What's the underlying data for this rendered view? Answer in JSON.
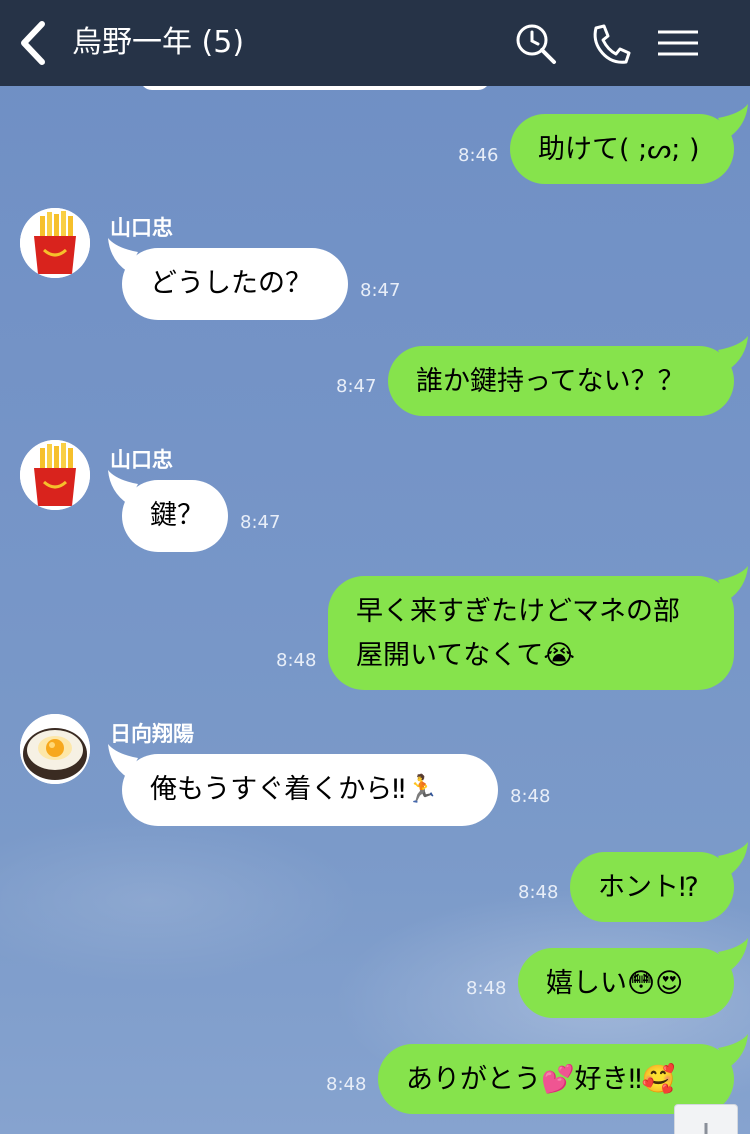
{
  "header": {
    "title": "烏野一年 (5)",
    "icons": [
      "back-chevron-icon",
      "search-icon",
      "phone-icon",
      "menu-icon"
    ]
  },
  "messages": [
    {
      "side": "out",
      "text": "助けて( ;ᔕ; )",
      "time": "8:46"
    },
    {
      "side": "in",
      "sender": "山口忠",
      "avatar": "fries-icon",
      "text": "どうしたの？",
      "time": "8:47"
    },
    {
      "side": "out",
      "text": "誰か鍵持ってない？？",
      "time": "8:47"
    },
    {
      "side": "in",
      "sender": "山口忠",
      "avatar": "fries-icon",
      "text": "鍵？",
      "time": "8:47"
    },
    {
      "side": "out",
      "text_line1": "早く来すぎたけどマネの部",
      "text_line2": "屋開いてなくて😭",
      "time": "8:48"
    },
    {
      "side": "in",
      "sender": "日向翔陽",
      "avatar": "egg-rice-icon",
      "text": "俺もうすぐ着くから‼🏃",
      "time": "8:48"
    },
    {
      "side": "out",
      "text": "ホント⁉",
      "time": "8:48"
    },
    {
      "side": "out",
      "text": "嬉しい😳😍",
      "time": "8:48"
    },
    {
      "side": "out",
      "text": "ありがとう💕好き‼🥰",
      "time": "8:48"
    }
  ],
  "colors": {
    "header_bg": "#263347",
    "chat_bg": "#7291c4",
    "bubble_out": "#86e34c",
    "bubble_in": "#ffffff"
  }
}
